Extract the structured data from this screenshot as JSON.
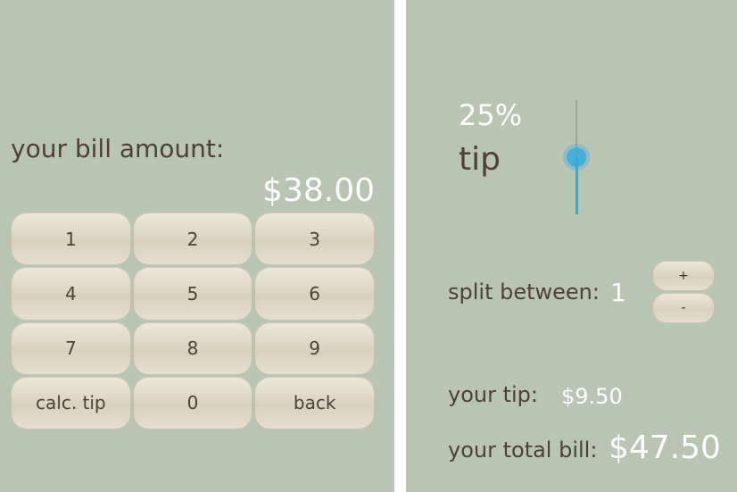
{
  "colors": {
    "background": "#b9c5b3",
    "text_dark": "#4e3f38",
    "text_light": "#ffffff",
    "accent": "#33a9e0",
    "button_face": "#e5dfcf"
  },
  "bill": {
    "label": "your bill amount:",
    "amount": "$38.00"
  },
  "keypad": {
    "keys": [
      "1",
      "2",
      "3",
      "4",
      "5",
      "6",
      "7",
      "8",
      "9",
      "calc. tip",
      "0",
      "back"
    ]
  },
  "tip": {
    "percent_label": "25%",
    "word": "tip",
    "slider_level": 0.5
  },
  "split": {
    "label": "split between:",
    "value": "1",
    "plus_label": "+",
    "minus_label": "-"
  },
  "results": {
    "tip_label": "your tip:",
    "tip_value": "$9.50",
    "total_label": "your total bill:",
    "total_value": "$47.50"
  }
}
